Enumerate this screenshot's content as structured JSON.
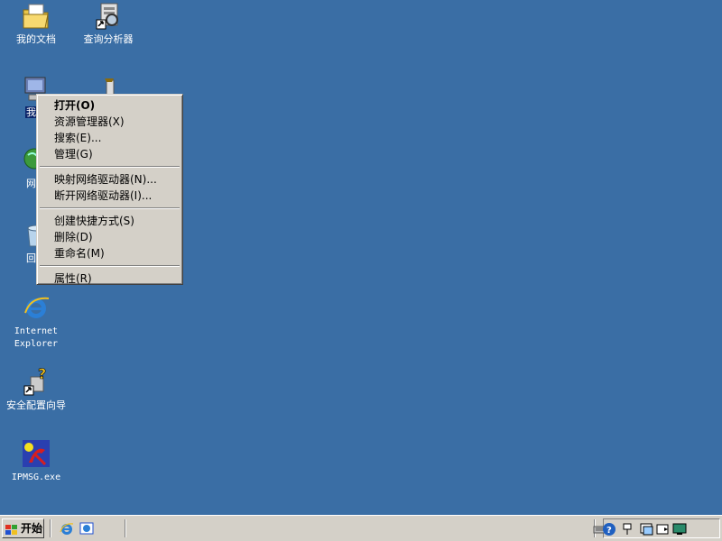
{
  "desktop": {
    "icons": [
      {
        "label": "我的文档",
        "icon": "my-documents-icon"
      },
      {
        "label": "查询分析器",
        "icon": "query-analyzer-icon"
      },
      {
        "label": "我的",
        "icon": "my-computer-icon"
      },
      {
        "label": "",
        "icon": "tools-shortcut-icon"
      },
      {
        "label": "网上",
        "icon": "network-places-icon"
      },
      {
        "label": "回收",
        "icon": "recycle-bin-icon"
      },
      {
        "label": "Internet Explorer",
        "label_line1": "Internet",
        "label_line2": "Explorer",
        "icon": "internet-explorer-icon"
      },
      {
        "label": "安全配置向导",
        "icon": "security-wizard-icon"
      },
      {
        "label": "IPMSG.exe",
        "icon": "ipmsg-icon"
      }
    ]
  },
  "context_menu": {
    "items": [
      {
        "label": "打开(O)",
        "default": true
      },
      {
        "label": "资源管理器(X)"
      },
      {
        "label": "搜索(E)..."
      },
      {
        "label": "管理(G)"
      },
      {
        "label": "映射网络驱动器(N)..."
      },
      {
        "label": "断开网络驱动器(I)..."
      },
      {
        "label": "创建快捷方式(S)"
      },
      {
        "label": "删除(D)"
      },
      {
        "label": "重命名(M)"
      },
      {
        "label": "属性(R)"
      }
    ]
  },
  "taskbar": {
    "start_label": "开始",
    "quick_launch": [
      "internet-explorer-icon",
      "show-desktop-icon"
    ],
    "tray_icons": [
      "keyboard-icon",
      "help-icon",
      "network-icon",
      "display-icon",
      "volume-icon",
      "monitor-icon"
    ]
  },
  "colors": {
    "desktop": "#3a6ea5",
    "selection": "#0a246a",
    "face": "#d4d0c8"
  }
}
